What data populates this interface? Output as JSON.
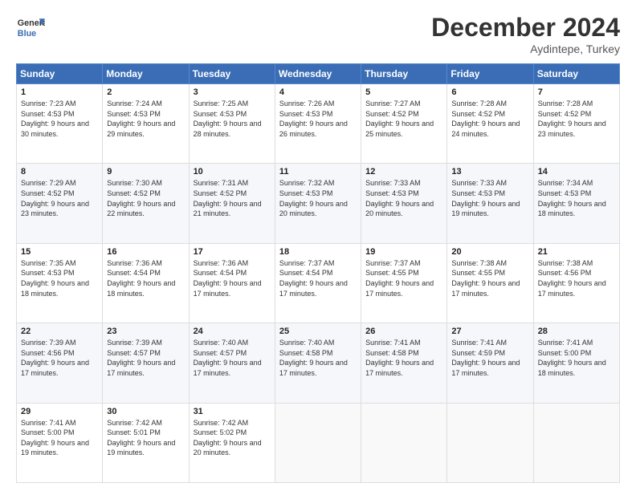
{
  "header": {
    "logo_line1": "General",
    "logo_line2": "Blue",
    "month_title": "December 2024",
    "location": "Aydintepe, Turkey"
  },
  "weekdays": [
    "Sunday",
    "Monday",
    "Tuesday",
    "Wednesday",
    "Thursday",
    "Friday",
    "Saturday"
  ],
  "weeks": [
    [
      {
        "day": "1",
        "sunrise": "7:23 AM",
        "sunset": "4:53 PM",
        "daylight": "9 hours and 30 minutes."
      },
      {
        "day": "2",
        "sunrise": "7:24 AM",
        "sunset": "4:53 PM",
        "daylight": "9 hours and 29 minutes."
      },
      {
        "day": "3",
        "sunrise": "7:25 AM",
        "sunset": "4:53 PM",
        "daylight": "9 hours and 28 minutes."
      },
      {
        "day": "4",
        "sunrise": "7:26 AM",
        "sunset": "4:53 PM",
        "daylight": "9 hours and 26 minutes."
      },
      {
        "day": "5",
        "sunrise": "7:27 AM",
        "sunset": "4:52 PM",
        "daylight": "9 hours and 25 minutes."
      },
      {
        "day": "6",
        "sunrise": "7:28 AM",
        "sunset": "4:52 PM",
        "daylight": "9 hours and 24 minutes."
      },
      {
        "day": "7",
        "sunrise": "7:28 AM",
        "sunset": "4:52 PM",
        "daylight": "9 hours and 23 minutes."
      }
    ],
    [
      {
        "day": "8",
        "sunrise": "7:29 AM",
        "sunset": "4:52 PM",
        "daylight": "9 hours and 23 minutes."
      },
      {
        "day": "9",
        "sunrise": "7:30 AM",
        "sunset": "4:52 PM",
        "daylight": "9 hours and 22 minutes."
      },
      {
        "day": "10",
        "sunrise": "7:31 AM",
        "sunset": "4:52 PM",
        "daylight": "9 hours and 21 minutes."
      },
      {
        "day": "11",
        "sunrise": "7:32 AM",
        "sunset": "4:53 PM",
        "daylight": "9 hours and 20 minutes."
      },
      {
        "day": "12",
        "sunrise": "7:33 AM",
        "sunset": "4:53 PM",
        "daylight": "9 hours and 20 minutes."
      },
      {
        "day": "13",
        "sunrise": "7:33 AM",
        "sunset": "4:53 PM",
        "daylight": "9 hours and 19 minutes."
      },
      {
        "day": "14",
        "sunrise": "7:34 AM",
        "sunset": "4:53 PM",
        "daylight": "9 hours and 18 minutes."
      }
    ],
    [
      {
        "day": "15",
        "sunrise": "7:35 AM",
        "sunset": "4:53 PM",
        "daylight": "9 hours and 18 minutes."
      },
      {
        "day": "16",
        "sunrise": "7:36 AM",
        "sunset": "4:54 PM",
        "daylight": "9 hours and 18 minutes."
      },
      {
        "day": "17",
        "sunrise": "7:36 AM",
        "sunset": "4:54 PM",
        "daylight": "9 hours and 17 minutes."
      },
      {
        "day": "18",
        "sunrise": "7:37 AM",
        "sunset": "4:54 PM",
        "daylight": "9 hours and 17 minutes."
      },
      {
        "day": "19",
        "sunrise": "7:37 AM",
        "sunset": "4:55 PM",
        "daylight": "9 hours and 17 minutes."
      },
      {
        "day": "20",
        "sunrise": "7:38 AM",
        "sunset": "4:55 PM",
        "daylight": "9 hours and 17 minutes."
      },
      {
        "day": "21",
        "sunrise": "7:38 AM",
        "sunset": "4:56 PM",
        "daylight": "9 hours and 17 minutes."
      }
    ],
    [
      {
        "day": "22",
        "sunrise": "7:39 AM",
        "sunset": "4:56 PM",
        "daylight": "9 hours and 17 minutes."
      },
      {
        "day": "23",
        "sunrise": "7:39 AM",
        "sunset": "4:57 PM",
        "daylight": "9 hours and 17 minutes."
      },
      {
        "day": "24",
        "sunrise": "7:40 AM",
        "sunset": "4:57 PM",
        "daylight": "9 hours and 17 minutes."
      },
      {
        "day": "25",
        "sunrise": "7:40 AM",
        "sunset": "4:58 PM",
        "daylight": "9 hours and 17 minutes."
      },
      {
        "day": "26",
        "sunrise": "7:41 AM",
        "sunset": "4:58 PM",
        "daylight": "9 hours and 17 minutes."
      },
      {
        "day": "27",
        "sunrise": "7:41 AM",
        "sunset": "4:59 PM",
        "daylight": "9 hours and 17 minutes."
      },
      {
        "day": "28",
        "sunrise": "7:41 AM",
        "sunset": "5:00 PM",
        "daylight": "9 hours and 18 minutes."
      }
    ],
    [
      {
        "day": "29",
        "sunrise": "7:41 AM",
        "sunset": "5:00 PM",
        "daylight": "9 hours and 19 minutes."
      },
      {
        "day": "30",
        "sunrise": "7:42 AM",
        "sunset": "5:01 PM",
        "daylight": "9 hours and 19 minutes."
      },
      {
        "day": "31",
        "sunrise": "7:42 AM",
        "sunset": "5:02 PM",
        "daylight": "9 hours and 20 minutes."
      },
      null,
      null,
      null,
      null
    ]
  ],
  "labels": {
    "sunrise": "Sunrise:",
    "sunset": "Sunset:",
    "daylight": "Daylight:"
  }
}
